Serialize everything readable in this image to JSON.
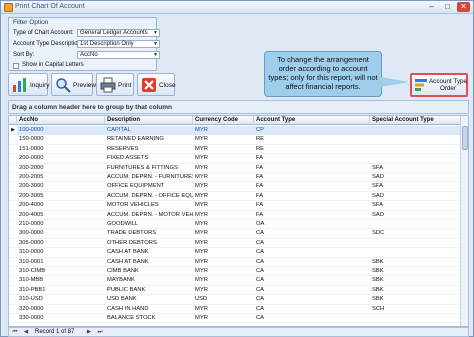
{
  "window": {
    "title": "Print Chart Of Account"
  },
  "filter": {
    "caption": "Filter Option",
    "fields": [
      {
        "label": "Type of Chart Account:",
        "value": "General Ledger Accounts"
      },
      {
        "label": "Account Type Description:",
        "value": "1st Description Only"
      },
      {
        "label": "Sort By:",
        "value": "AccNo"
      }
    ],
    "show_caps_label": "Show in Capital Letters"
  },
  "toolbar": {
    "inquiry": "Inquiry",
    "preview": "Preview",
    "print": "Print",
    "close": "Close",
    "account_type_order": "Account Type Order"
  },
  "callout": "To change the arrangement order according to account types; only for this report, will not affect financial reports.",
  "group_hint": "Drag a column header here to group by that column",
  "grid": {
    "columns": [
      "AccNo",
      "Description",
      "Currency Code",
      "Account Type",
      "Special Account Type"
    ],
    "rows": [
      [
        "100-0000",
        "CAPITAL",
        "MYR",
        "CP",
        ""
      ],
      [
        "150-0000",
        "RETAINED EARNING",
        "MYR",
        "RE",
        ""
      ],
      [
        "151-0000",
        "RESERVES",
        "MYR",
        "RE",
        ""
      ],
      [
        "200-0000",
        "FIXED ASSETS",
        "MYR",
        "FA",
        ""
      ],
      [
        "200-2000",
        "FURNITURES & FITTINGS",
        "MYR",
        "FA",
        "SFA"
      ],
      [
        "200-2005",
        "ACCUM. DEPRN. - FURNITURES & FI...",
        "MYR",
        "FA",
        "SAD"
      ],
      [
        "200-3000",
        "OFFICE EQUIPMENT",
        "MYR",
        "FA",
        "SFA"
      ],
      [
        "200-3005",
        "ACCUM. DEPRN. - OFFICE EQUIPM...",
        "MYR",
        "FA",
        "SAD"
      ],
      [
        "200-4000",
        "MOTOR VEHICLES",
        "MYR",
        "FA",
        "SFA"
      ],
      [
        "200-4005",
        "ACCUM. DEPRN. - MOTOR VEHICLES",
        "MYR",
        "FA",
        "SAD"
      ],
      [
        "210-0000",
        "GOODWILL",
        "MYR",
        "OA",
        ""
      ],
      [
        "300-0000",
        "TRADE DEBTORS",
        "MYR",
        "CA",
        "SDC"
      ],
      [
        "305-0000",
        "OTHER DEBTORS",
        "MYR",
        "CA",
        ""
      ],
      [
        "310-0000",
        "CASH AT BANK",
        "MYR",
        "CA",
        ""
      ],
      [
        "310-0001",
        "CASH AT BANK",
        "MYR",
        "CA",
        "SBK"
      ],
      [
        "310-CIMB",
        "CIMB BANK",
        "MYR",
        "CA",
        "SBK"
      ],
      [
        "310-MBB",
        "MAYBANK",
        "MYR",
        "CA",
        "SBK"
      ],
      [
        "310-PBB1",
        "PUBLIC BANK",
        "MYR",
        "CA",
        "SBK"
      ],
      [
        "310-USD",
        "USD BANK",
        "USD",
        "CA",
        "SBK"
      ],
      [
        "320-0000",
        "CASH IN HAND",
        "MYR",
        "CA",
        "SCH"
      ],
      [
        "330-0000",
        "BALANCE STOCK",
        "MYR",
        "CA",
        ""
      ]
    ]
  },
  "navigator": {
    "record_text": "Record 1 of 87"
  }
}
